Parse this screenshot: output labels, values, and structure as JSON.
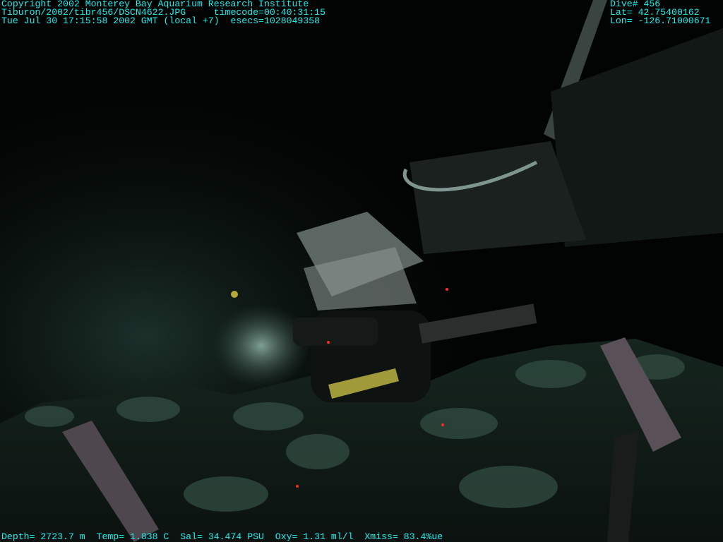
{
  "header_left": {
    "copyright": "Copyright 2002 Monterey Bay Aquarium Research Institute",
    "file_line": "Tiburon/2002/tibr456/DSCN4622.JPG     timecode=00:40:31:15",
    "date_line": "Tue Jul 30 17:15:58 2002 GMT (local +7)  esecs=1028049358"
  },
  "header_right": {
    "dive": "Dive# 456",
    "lat": "Lat= 42.75400162",
    "lon": "Lon= -126.71000671"
  },
  "footer": {
    "sensors": "Depth= 2723.7 m  Temp= 1.838 C  Sal= 34.474 PSU  Oxy= 1.31 ml/l  Xmiss= 83.4%ue"
  },
  "colors": {
    "overlay_text": "#19f0f0"
  }
}
